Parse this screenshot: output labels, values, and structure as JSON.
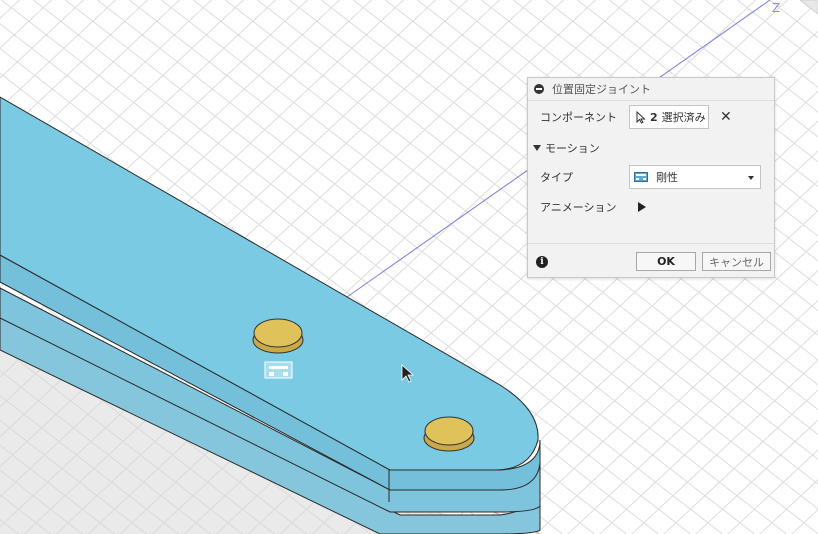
{
  "viewport": {
    "axis_label": "Z",
    "colors": {
      "part_blue": "#7fc9e1",
      "bolt": "#e0c25a",
      "grid": "#d8d8d8",
      "axis": "#6e6ee0"
    }
  },
  "panel": {
    "title": "位置固定ジョイント",
    "component_label": "コンポーネント",
    "selection_count": "2",
    "selection_text": "選択済み",
    "motion_label": "モーション",
    "type_label": "タイプ",
    "type_value": "剛性",
    "animation_label": "アニメーション",
    "ok_label": "OK",
    "cancel_label": "キャンセル",
    "info_glyph": "i"
  }
}
